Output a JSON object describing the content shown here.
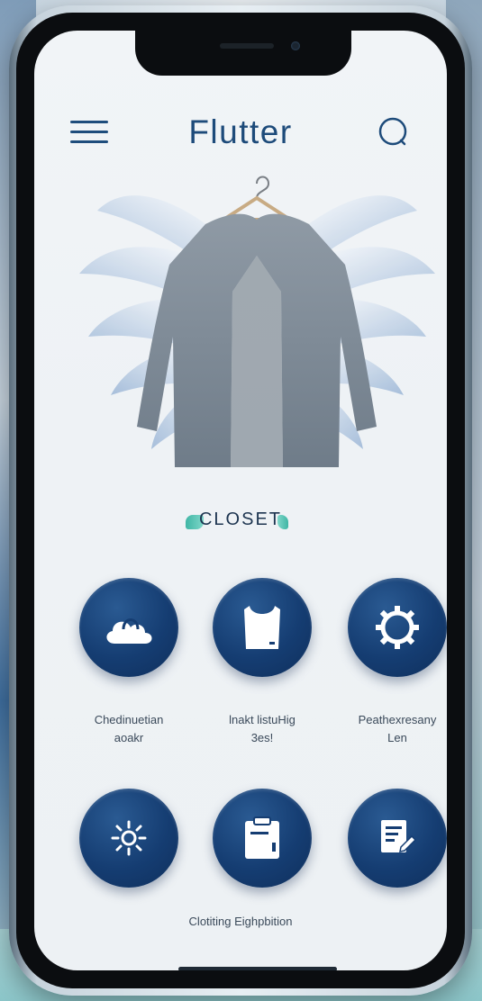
{
  "app": {
    "title": "Flutter"
  },
  "hero": {
    "label": "CLOSET"
  },
  "grid": {
    "items": [
      {
        "line1": "Chedinuetian",
        "line2": "aoakr",
        "icon": "cloud-hanger-icon"
      },
      {
        "line1": "lnakt listuHig",
        "line2": "3es!",
        "icon": "tank-top-icon"
      },
      {
        "line1": "Peathexresany",
        "line2": "Len",
        "icon": "gear-icon"
      },
      {
        "icon": "sun-icon"
      },
      {
        "icon": "clipboard-icon"
      },
      {
        "icon": "document-edit-icon"
      }
    ],
    "footer_caption": "Clotiting Eighpbition"
  },
  "colors": {
    "primary": "#1d4b7a",
    "tile": "#153d72",
    "accent": "#3fb6a5",
    "screen_bg": "#f1f4f7"
  }
}
